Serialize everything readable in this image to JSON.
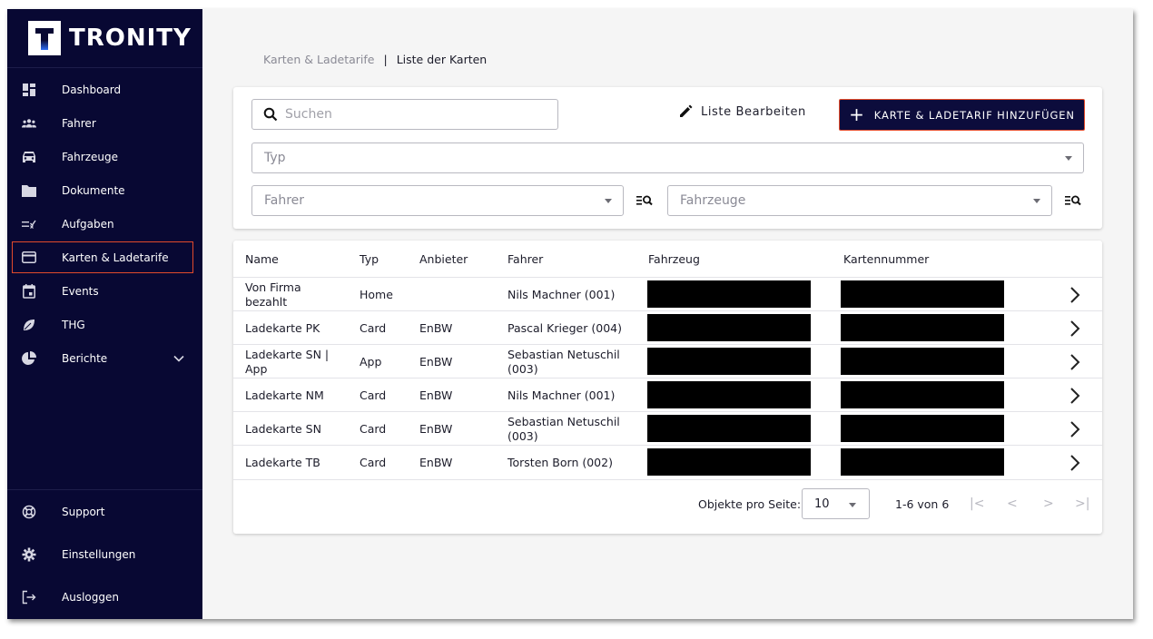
{
  "app": {
    "logo_letter": "T",
    "logo_text": "TRONITY"
  },
  "colors": {
    "sidebar_bg": "#080833",
    "accent_outline": "#e24a2b",
    "primary_button": "#0c0c3c"
  },
  "sidebar": {
    "items": [
      {
        "label": "Dashboard",
        "icon": "dashboard-icon"
      },
      {
        "label": "Fahrer",
        "icon": "people-icon"
      },
      {
        "label": "Fahrzeuge",
        "icon": "car-icon"
      },
      {
        "label": "Dokumente",
        "icon": "folder-icon"
      },
      {
        "label": "Aufgaben",
        "icon": "checklist-icon"
      },
      {
        "label": "Karten & Ladetarife",
        "icon": "credit-card-icon",
        "active": true
      },
      {
        "label": "Events",
        "icon": "calendar-icon"
      },
      {
        "label": "THG",
        "icon": "leaf-icon"
      },
      {
        "label": "Berichte",
        "icon": "pie-chart-icon",
        "expandable": true
      }
    ],
    "bottom_items": [
      {
        "label": "Support",
        "icon": "lifebuoy-icon"
      },
      {
        "label": "Einstellungen",
        "icon": "gear-icon"
      },
      {
        "label": "Ausloggen",
        "icon": "logout-icon"
      }
    ]
  },
  "breadcrumb": {
    "parent": "Karten & Ladetarife",
    "separator": "|",
    "current": "Liste der Karten"
  },
  "filters": {
    "search_placeholder": "Suchen",
    "edit_label": "Liste Bearbeiten",
    "add_label": "KARTE & LADETARIF HINZUFÜGEN",
    "add_plus": "+",
    "type_placeholder": "Typ",
    "driver_placeholder": "Fahrer",
    "vehicle_placeholder": "Fahrzeuge"
  },
  "table": {
    "headers": {
      "name": "Name",
      "type": "Typ",
      "provider": "Anbieter",
      "driver": "Fahrer",
      "vehicle": "Fahrzeug",
      "card_number": "Kartennummer"
    },
    "rows": [
      {
        "name": "Von Firma bezahlt",
        "type": "Home",
        "provider": "",
        "driver": "Nils Machner (001)"
      },
      {
        "name": "Ladekarte PK",
        "type": "Card",
        "provider": "EnBW",
        "driver": "Pascal Krieger (004)"
      },
      {
        "name": "Ladekarte SN | App",
        "type": "App",
        "provider": "EnBW",
        "driver": "Sebastian Netuschil (003)"
      },
      {
        "name": "Ladekarte NM",
        "type": "Card",
        "provider": "EnBW",
        "driver": "Nils Machner (001)"
      },
      {
        "name": "Ladekarte SN",
        "type": "Card",
        "provider": "EnBW",
        "driver": "Sebastian Netuschil (003)"
      },
      {
        "name": "Ladekarte TB",
        "type": "Card",
        "provider": "EnBW",
        "driver": "Torsten Born (002)"
      }
    ]
  },
  "pagination": {
    "per_page_label": "Objekte pro Seite:",
    "per_page_value": "10",
    "range": "1-6 von 6",
    "first": "|<",
    "prev": "<",
    "next": ">",
    "last": ">|"
  }
}
